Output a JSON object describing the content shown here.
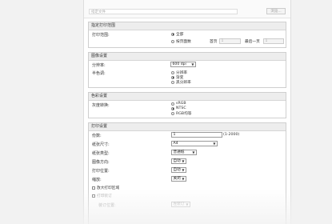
{
  "top": {
    "path_placeholder": "指定文件",
    "browse_label": "浏览..."
  },
  "range": {
    "title": "指定打印范围",
    "label": "打印范围:",
    "opt_all": "全部",
    "opt_pages": "按页面数",
    "first_label": "首页",
    "first_value": "1",
    "last_label": "最后一页",
    "last_value": "1"
  },
  "image": {
    "title": "图像设置",
    "resolution_label": "分辨率:",
    "resolution_value": "600 dpi",
    "halftone_label": "半色调:",
    "halftone_options": [
      "分辨率",
      "渐变",
      "黑分辨率"
    ]
  },
  "color": {
    "title": "色彩设置",
    "gray_label": "灰度转换:",
    "options": [
      "sRGB",
      "NTSC",
      "RGB均等"
    ]
  },
  "print": {
    "title": "打印设置",
    "copies_label": "份数:",
    "copies_value": "1",
    "copies_range": "(1-2000)",
    "paper_size_label": "纸张尺寸:",
    "paper_size_value": "A4",
    "paper_type_label": "纸张类型:",
    "paper_type_value": "普通纸",
    "orientation_label": "图像方向:",
    "orientation_value": "自动",
    "position_label": "打印位置:",
    "position_value": "自动",
    "zoom_label": "缩放:",
    "zoom_value": "关闭",
    "enlarge_label": "放大打印区域",
    "binding_label": "打印装订",
    "binding_pos_label": "装订位置:",
    "binding_pos_value": "左装订"
  }
}
